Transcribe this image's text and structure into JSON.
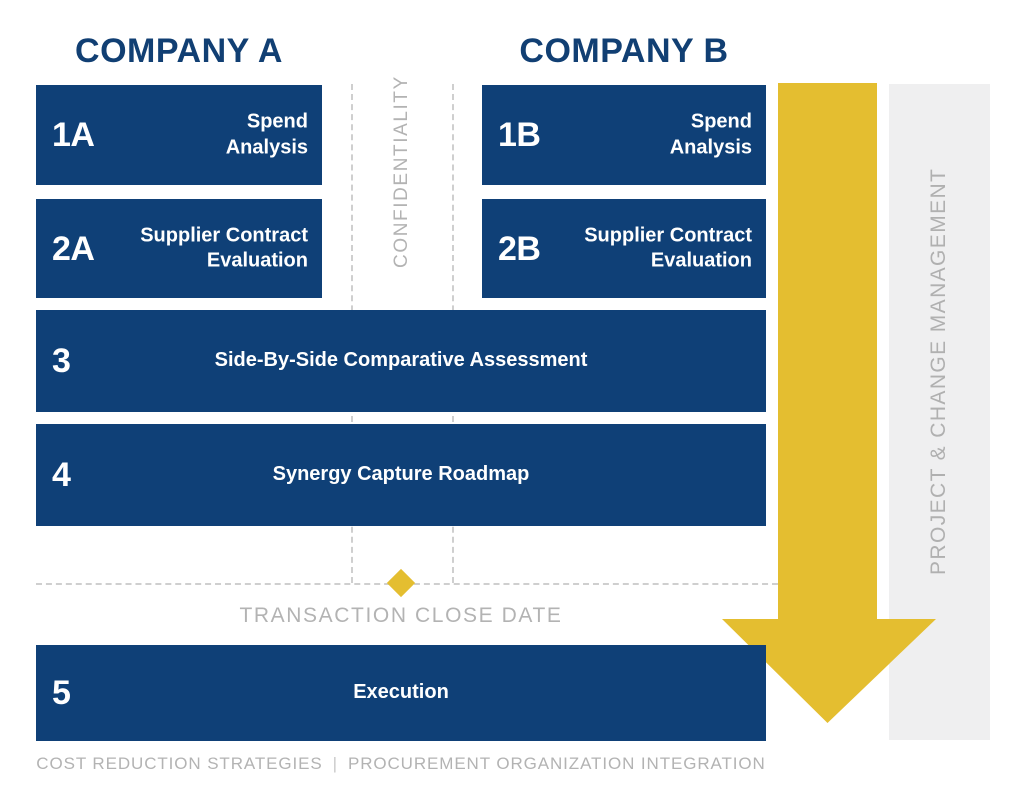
{
  "headers": {
    "company_a": "COMPANY A",
    "company_b": "COMPANY B"
  },
  "colors": {
    "blue": "#0F4077",
    "yellow": "#E4BE30",
    "grey_panel": "#EFEFF0",
    "grey_text": "#B3B3B3",
    "header_blue": "#113F73"
  },
  "boxes": [
    {
      "id": "1A",
      "number": "1A",
      "label": "Spend\nAnalysis",
      "label_line1": "Spend",
      "label_line2": "Analysis",
      "column": "a",
      "align": "right"
    },
    {
      "id": "2A",
      "number": "2A",
      "label": "Supplier Contract\nEvaluation",
      "label_line1": "Supplier Contract",
      "label_line2": "Evaluation",
      "column": "a",
      "align": "right"
    },
    {
      "id": "1B",
      "number": "1B",
      "label": "Spend\nAnalysis",
      "label_line1": "Spend",
      "label_line2": "Analysis",
      "column": "b",
      "align": "right"
    },
    {
      "id": "2B",
      "number": "2B",
      "label": "Supplier Contract\nEvaluation",
      "label_line1": "Supplier Contract",
      "label_line2": "Evaluation",
      "column": "b",
      "align": "right"
    },
    {
      "id": "3",
      "number": "3",
      "label": "Side-By-Side Comparative Assessment",
      "column": "full",
      "align": "center"
    },
    {
      "id": "4",
      "number": "4",
      "label": "Synergy Capture Roadmap",
      "column": "full",
      "align": "center"
    },
    {
      "id": "5",
      "number": "5",
      "label": "Execution",
      "column": "full",
      "align": "center"
    }
  ],
  "vertical_labels": {
    "confidentiality": "CONFIDENTIALITY",
    "project_change_management": "PROJECT & CHANGE MANAGEMENT"
  },
  "milestone": {
    "label": "TRANSACTION CLOSE DATE"
  },
  "footer": {
    "left": "COST REDUCTION STRATEGIES",
    "separator": "|",
    "right": "PROCUREMENT ORGANIZATION INTEGRATION"
  }
}
